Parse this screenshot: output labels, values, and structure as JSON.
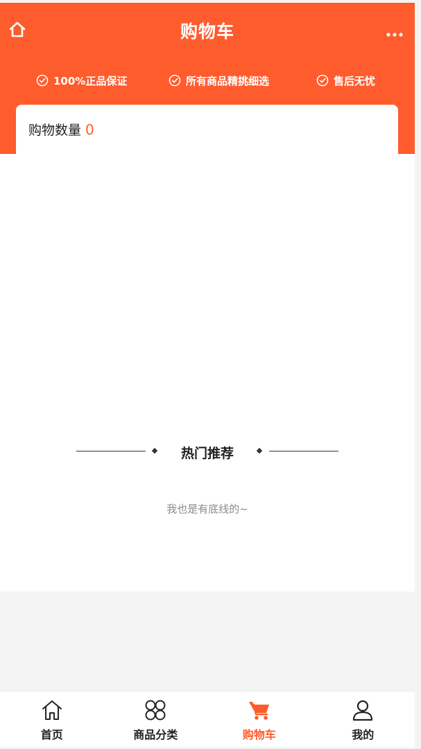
{
  "header": {
    "title": "购物车",
    "home_icon": "home-icon",
    "more_icon": "more-dots-icon",
    "accent_color": "#ff5c2e"
  },
  "guarantees": [
    {
      "icon": "check-circle-icon",
      "label": "100%正品保证"
    },
    {
      "icon": "check-circle-icon",
      "label": "所有商品精挑细选"
    },
    {
      "icon": "check-circle-icon",
      "label": "售后无忧"
    }
  ],
  "cart": {
    "count_label": "购物数量",
    "count_value": "0"
  },
  "recommend": {
    "title": "热门推荐",
    "bottom_text": "我也是有底线的~"
  },
  "tabbar": {
    "items": [
      {
        "label": "首页",
        "icon": "home-icon",
        "active": false
      },
      {
        "label": "商品分类",
        "icon": "category-grid-icon",
        "active": false
      },
      {
        "label": "购物车",
        "icon": "cart-icon",
        "active": true
      },
      {
        "label": "我的",
        "icon": "user-icon",
        "active": false
      }
    ],
    "active_color": "#ff5c2e"
  }
}
